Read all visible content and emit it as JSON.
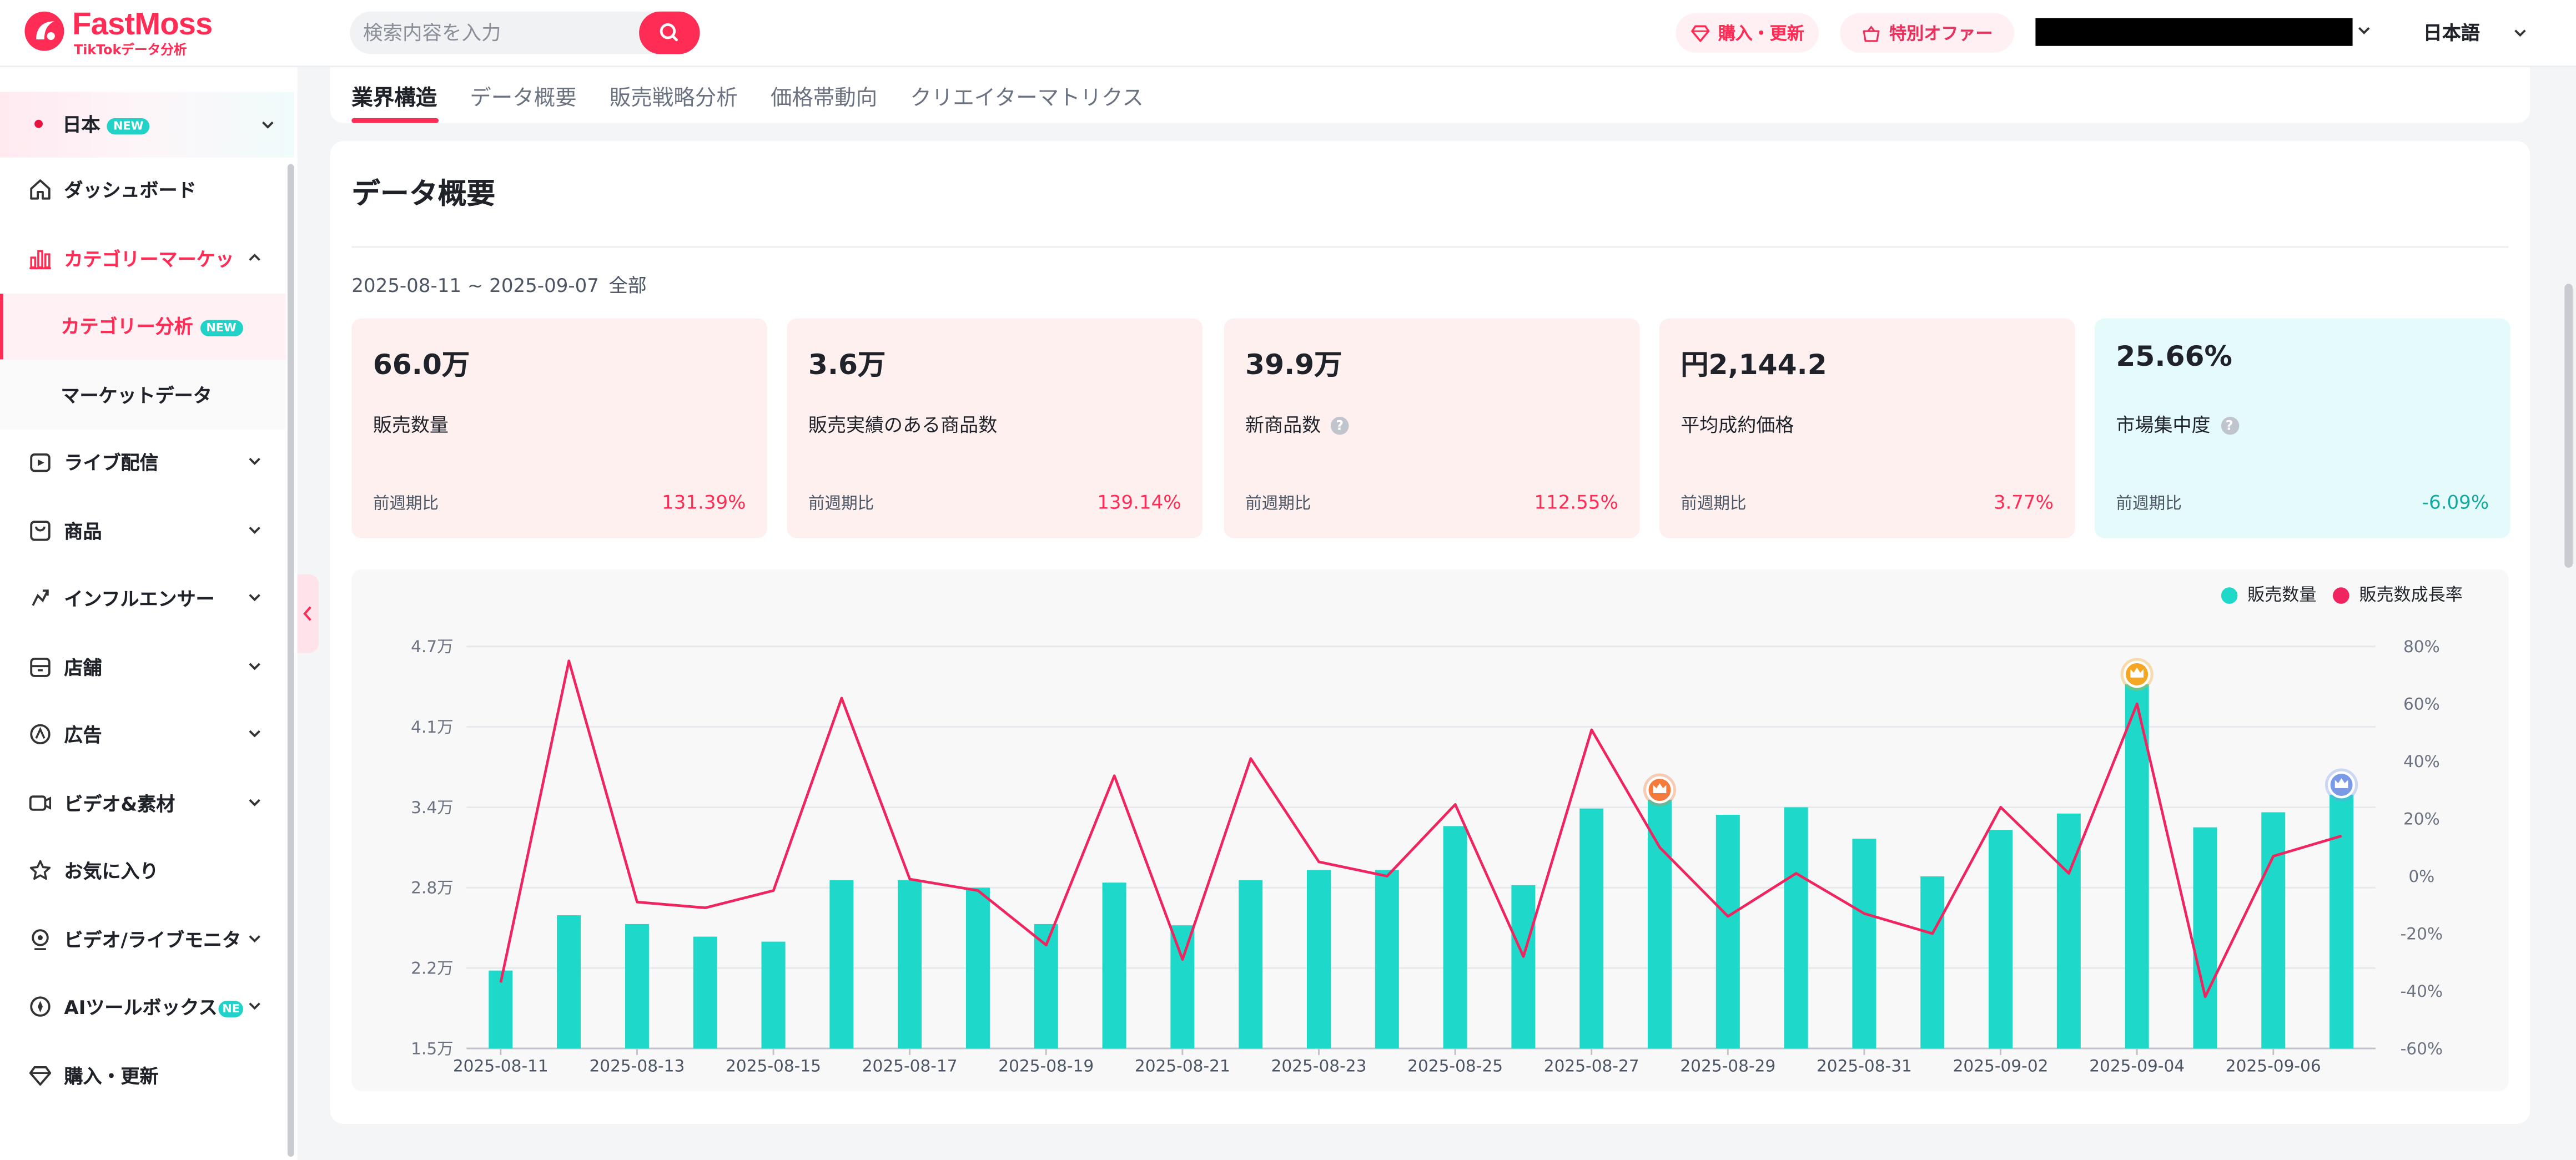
{
  "header": {
    "logo_text": "FastMoss",
    "logo_sub": "TikTokデータ分析",
    "search_placeholder": "検索内容を入力",
    "buy_label": "購入・更新",
    "offer_label": "特別オファー",
    "language": "日本語"
  },
  "sidebar": {
    "region": {
      "label": "日本",
      "badge": "NEW"
    },
    "items": [
      {
        "label": "ダッシュボード",
        "icon": "home-icon"
      },
      {
        "label": "カテゴリーマーケッ",
        "icon": "bar-chart-icon",
        "expanded": true
      },
      {
        "label": "ライブ配信",
        "icon": "live-icon"
      },
      {
        "label": "商品",
        "icon": "shopping-bag-icon"
      },
      {
        "label": "インフルエンサー",
        "icon": "influencer-icon"
      },
      {
        "label": "店舗",
        "icon": "store-icon"
      },
      {
        "label": "広告",
        "icon": "ad-icon"
      },
      {
        "label": "ビデオ&素材",
        "icon": "video-icon"
      },
      {
        "label": "お気に入り",
        "icon": "star-icon"
      },
      {
        "label": "ビデオ/ライブモニタ",
        "icon": "monitor-icon"
      },
      {
        "label": "AIツールボックス",
        "icon": "ai-toolbox-icon",
        "badge": "NE"
      },
      {
        "label": "購入・更新",
        "icon": "diamond-icon"
      }
    ],
    "sub_items": [
      {
        "label": "カテゴリー分析",
        "badge": "NEW",
        "active": true
      },
      {
        "label": "マーケットデータ"
      }
    ]
  },
  "tabs": [
    {
      "label": "業界構造",
      "active": true
    },
    {
      "label": "データ概要"
    },
    {
      "label": "販売戦略分析"
    },
    {
      "label": "価格帯動向"
    },
    {
      "label": "クリエイターマトリクス"
    }
  ],
  "section": {
    "title": "データ概要",
    "date_range": "2025-08-11 ~ 2025-09-07",
    "scope": "全部"
  },
  "stats": [
    {
      "value": "66.0万",
      "label": "販売数量",
      "compare_label": "前週期比",
      "change": "131.39%",
      "help": false
    },
    {
      "value": "3.6万",
      "label": "販売実績のある商品数",
      "compare_label": "前週期比",
      "change": "139.14%",
      "help": false
    },
    {
      "value": "39.9万",
      "label": "新商品数",
      "compare_label": "前週期比",
      "change": "112.55%",
      "help": true
    },
    {
      "value": "円2,144.2",
      "label": "平均成約価格",
      "compare_label": "前週期比",
      "change": "3.77%",
      "help": false
    },
    {
      "value": "25.66%",
      "label": "市場集中度",
      "compare_label": "前週期比",
      "change": "-6.09%",
      "help": true
    }
  ],
  "colors": {
    "brand": "#ff2d55",
    "bar": "#1ed8c9",
    "line": "#f0245f",
    "stat_pink": "#fff0f0",
    "stat_cyan": "#e5fbfb"
  },
  "chart_data": {
    "type": "bar",
    "x": [
      "2025-08-11",
      "2025-08-12",
      "2025-08-13",
      "2025-08-14",
      "2025-08-15",
      "2025-08-16",
      "2025-08-17",
      "2025-08-18",
      "2025-08-19",
      "2025-08-20",
      "2025-08-21",
      "2025-08-22",
      "2025-08-23",
      "2025-08-24",
      "2025-08-25",
      "2025-08-26",
      "2025-08-27",
      "2025-08-28",
      "2025-08-29",
      "2025-08-30",
      "2025-08-31",
      "2025-09-01",
      "2025-09-02",
      "2025-09-03",
      "2025-09-04",
      "2025-09-05",
      "2025-09-06",
      "2025-09-07"
    ],
    "x_tick_labels": [
      "2025-08-11",
      "2025-08-13",
      "2025-08-15",
      "2025-08-17",
      "2025-08-19",
      "2025-08-21",
      "2025-08-23",
      "2025-08-25",
      "2025-08-27",
      "2025-08-29",
      "2025-08-31",
      "2025-09-02",
      "2025-09-04",
      "2025-09-06"
    ],
    "series": [
      {
        "name": "販売数量",
        "type": "bar",
        "axis": "left",
        "values": [
          2.12,
          2.56,
          2.49,
          2.39,
          2.35,
          2.84,
          2.84,
          2.78,
          2.49,
          2.82,
          2.48,
          2.84,
          2.92,
          2.92,
          3.27,
          2.8,
          3.41,
          3.48,
          3.36,
          3.42,
          3.17,
          2.87,
          3.24,
          3.37,
          4.4,
          3.26,
          3.38,
          3.52
        ]
      },
      {
        "name": "販売数成長率",
        "type": "line",
        "axis": "right",
        "values": [
          -37,
          75,
          -9,
          -11,
          -5,
          62,
          -1,
          -5,
          -24,
          35,
          -29,
          41,
          5,
          0,
          25,
          -28,
          51,
          10,
          -14,
          1,
          -13,
          -20,
          24,
          1,
          60,
          -42,
          7,
          14
        ]
      }
    ],
    "y_left": {
      "ticks": [
        "1.5万",
        "2.2万",
        "2.8万",
        "3.4万",
        "4.1万",
        "4.7万"
      ],
      "range": [
        1.5,
        4.7
      ]
    },
    "y_right": {
      "ticks": [
        "-60%",
        "-40%",
        "-20%",
        "0%",
        "20%",
        "40%",
        "60%",
        "80%"
      ],
      "range": [
        -60,
        80
      ]
    },
    "highlights": [
      {
        "index": 17,
        "color": "#f47b3b",
        "icon": "crown-badge-icon"
      },
      {
        "index": 24,
        "color": "#f5a623",
        "icon": "crown-badge-icon"
      },
      {
        "index": 27,
        "color": "#7b9ae6",
        "icon": "crown-badge-icon"
      }
    ],
    "legend_position": "top-right",
    "grid": true
  }
}
